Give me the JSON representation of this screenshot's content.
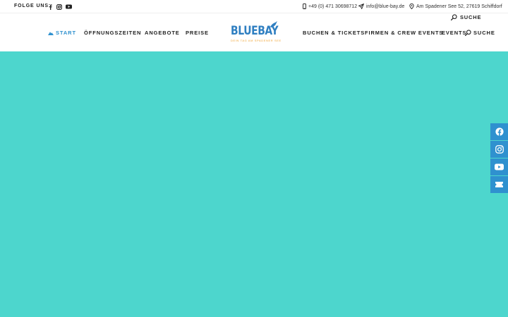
{
  "topbar": {
    "follow_label": "FOLGE UNS:",
    "social_icons": [
      "facebook-icon",
      "instagram-icon",
      "youtube-icon"
    ],
    "phone": "+49 (0) 471 30698712",
    "email": "info@blue-bay.de",
    "address": "Am Spadener See 52, 27619 Schiffdorf",
    "search_label": "SUCHE"
  },
  "nav": {
    "left": [
      "START",
      "ÖFFNUNGSZEITEN",
      "ANGEBOTE",
      "PREISE"
    ],
    "right": [
      "BUCHEN & TICKETS",
      "FIRMEN & CREW EVENTS",
      "EVENTS"
    ],
    "search_label": "SUCHE",
    "active": "START"
  },
  "logo": {
    "text": "BLUEBAY",
    "tagline": "DEIN TAG AM SPADENER SEE"
  },
  "side_social": [
    "facebook-icon",
    "instagram-icon",
    "youtube-icon",
    "ticket-icon"
  ],
  "colors": {
    "accent": "#2f91cf",
    "hero": "#4dd6cd",
    "logo_blue": "#2f7fc1",
    "logo_orange": "#f0a63a"
  }
}
